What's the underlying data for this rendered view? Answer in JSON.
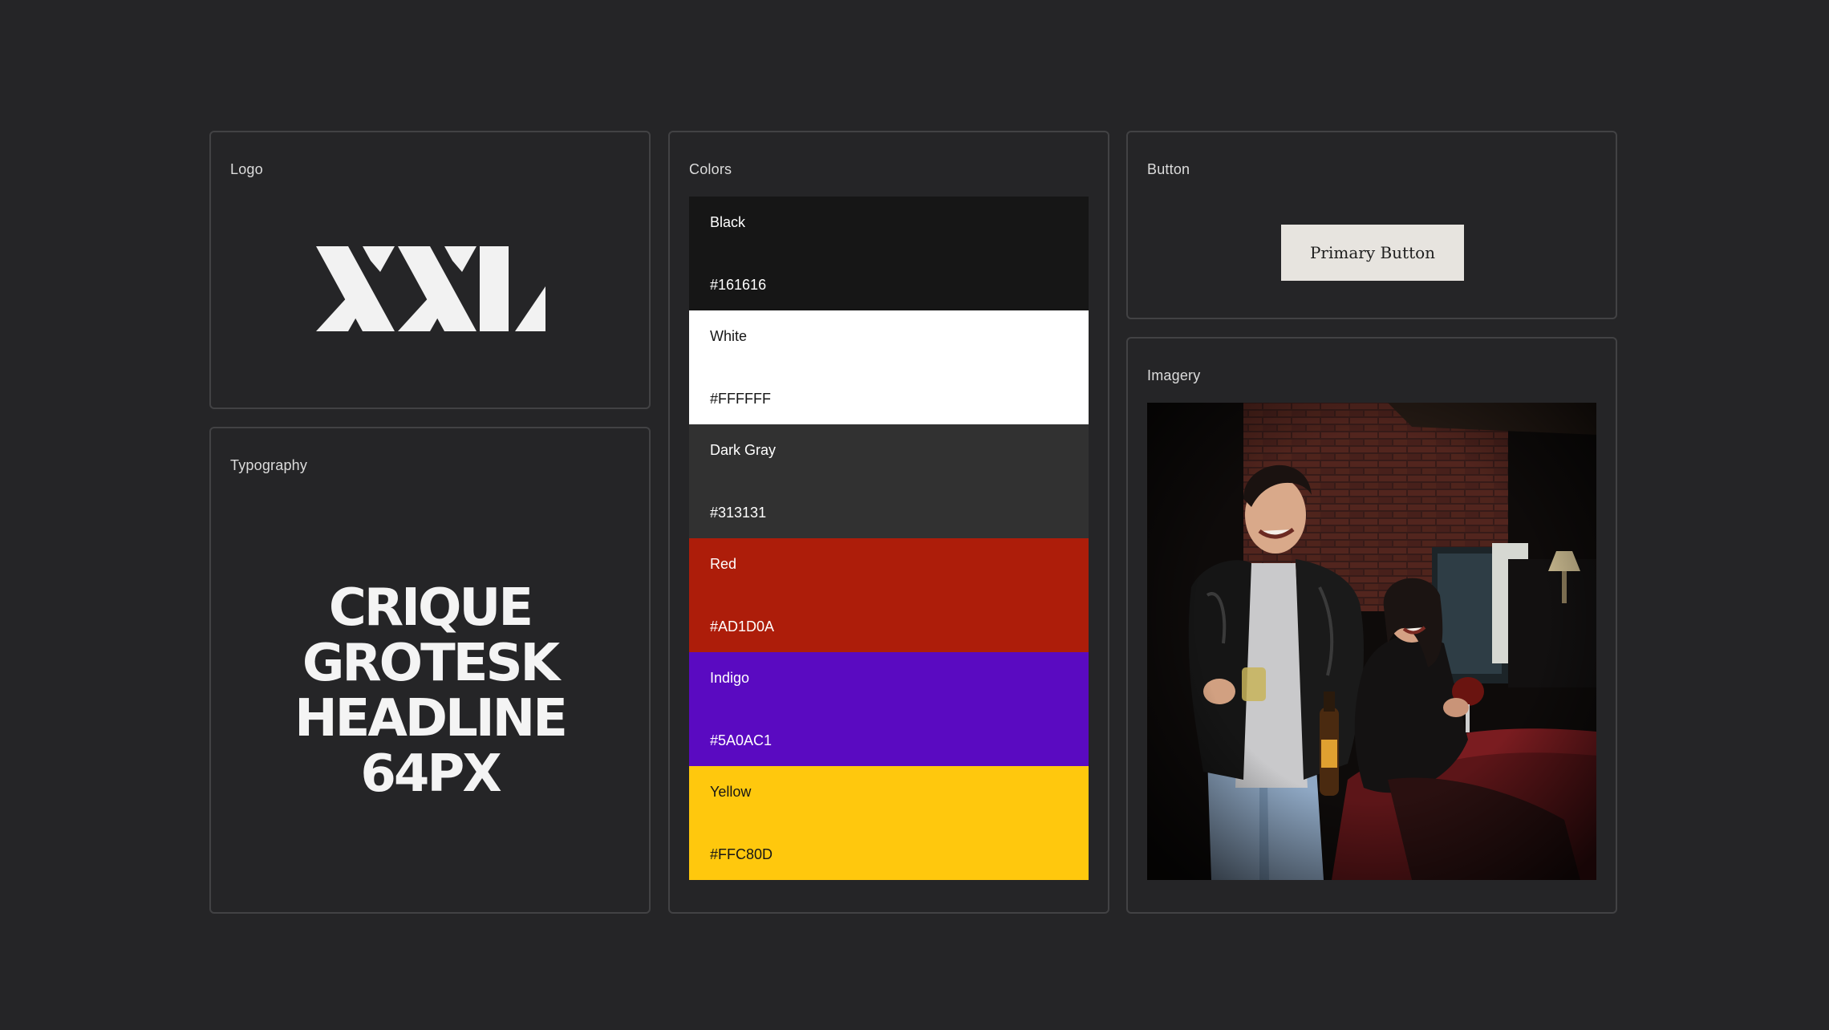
{
  "logo": {
    "label": "Logo",
    "mark_text": "XXL"
  },
  "typography": {
    "label": "Typography",
    "sample": "CRIQUE\nGROTESK\nHEADLINE\n64PX"
  },
  "colors": {
    "label": "Colors",
    "swatches": [
      {
        "name": "Black",
        "hex": "#161616",
        "text_color": "#ffffff"
      },
      {
        "name": "White",
        "hex": "#FFFFFF",
        "text_color": "#161616"
      },
      {
        "name": "Dark Gray",
        "hex": "#313131",
        "text_color": "#ffffff"
      },
      {
        "name": "Red",
        "hex": "#AD1D0A",
        "text_color": "#ffffff"
      },
      {
        "name": "Indigo",
        "hex": "#5A0AC1",
        "text_color": "#ffffff"
      },
      {
        "name": "Yellow",
        "hex": "#FFC80D",
        "text_color": "#161616"
      }
    ]
  },
  "button": {
    "label": "Button",
    "primary_label": "Primary Button"
  },
  "imagery": {
    "label": "Imagery",
    "photo_icon": "photo-of-two-people-laughing"
  }
}
